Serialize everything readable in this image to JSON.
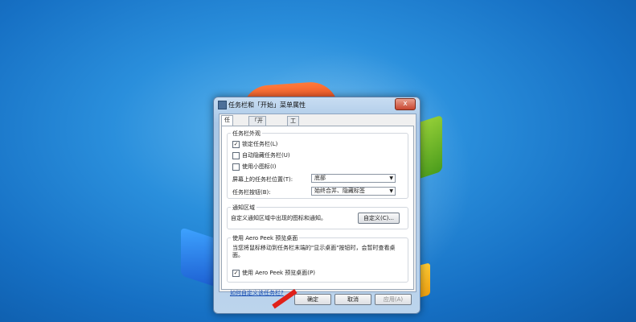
{
  "window": {
    "title": "任务栏和「开始」菜单属性",
    "close": "x"
  },
  "tabs": [
    {
      "label": "任务栏"
    },
    {
      "label": "「开始」菜单"
    },
    {
      "label": "工具栏"
    }
  ],
  "taskbar_appearance": {
    "group_label": "任务栏外观",
    "options": [
      {
        "label": "锁定任务栏(L)",
        "checked": "✓"
      },
      {
        "label": "自动隐藏任务栏(U)",
        "checked": ""
      },
      {
        "label": "使用小图标(I)",
        "checked": ""
      }
    ],
    "position_label": "屏幕上的任务栏位置(T):",
    "position_value": "底部",
    "buttons_label": "任务栏按钮(B):",
    "buttons_value": "始终合并、隐藏标签"
  },
  "notification_area": {
    "group_label": "通知区域",
    "description": "自定义通知区域中出现的图标和通知。",
    "customize_button": "自定义(C)..."
  },
  "aero_peek": {
    "group_label": "使用 Aero Peek 预览桌面",
    "description": "当您将鼠标移动到任务栏末端的\"显示桌面\"按钮时，会暂时查看桌面。",
    "option": {
      "label": "使用 Aero Peek 预览桌面(P)",
      "checked": "✓"
    }
  },
  "help_link": "如何自定义该任务栏?",
  "footer": {
    "ok": "确定",
    "cancel": "取消",
    "apply": "应用(A)"
  }
}
